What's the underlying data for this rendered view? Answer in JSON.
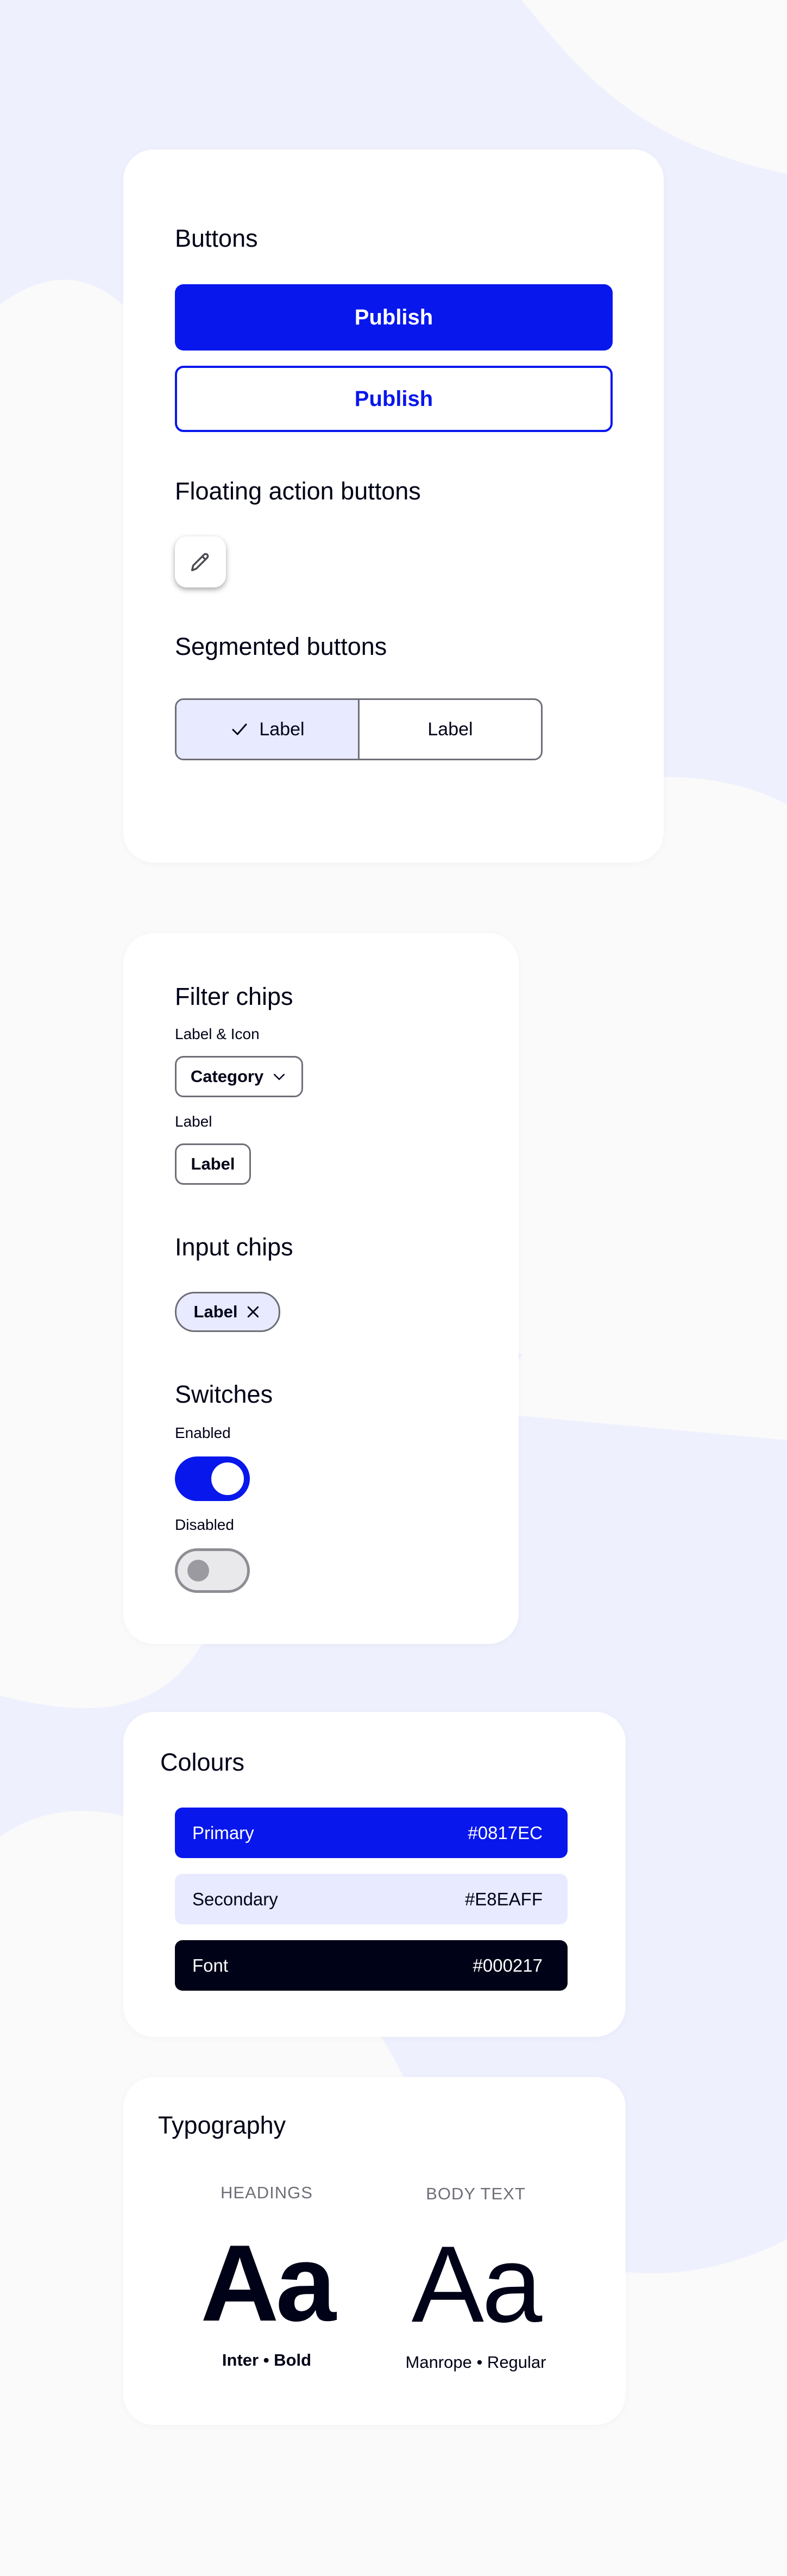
{
  "buttons_card": {
    "title": "Buttons",
    "primary_label": "Publish",
    "outline_label": "Publish",
    "fab_title": "Floating action buttons",
    "fab_icon": "pencil-icon",
    "segmented_title": "Segmented buttons",
    "segmented": [
      {
        "label": "Label",
        "selected": true
      },
      {
        "label": "Label",
        "selected": false
      }
    ]
  },
  "chips_card": {
    "filter_title": "Filter chips",
    "label_icon_caption": "Label & Icon",
    "category_chip": "Category",
    "label_caption": "Label",
    "label_chip": "Label",
    "input_title": "Input chips",
    "input_chip": "Label",
    "switches_title": "Switches",
    "enabled_caption": "Enabled",
    "disabled_caption": "Disabled",
    "switch_enabled_on": true,
    "switch_disabled_on": false
  },
  "colours_card": {
    "title": "Colours",
    "swatches": [
      {
        "name": "Primary",
        "hex": "#0817EC"
      },
      {
        "name": "Secondary",
        "hex": "#E8EAFF"
      },
      {
        "name": "Font",
        "hex": "#000217"
      }
    ]
  },
  "typography_card": {
    "title": "Typography",
    "headings": {
      "caption": "HEADINGS",
      "sample": "Aa",
      "name": "Inter • Bold"
    },
    "body": {
      "caption": "BODY TEXT",
      "sample": "Aa",
      "name": "Manrope • Regular"
    }
  },
  "theme": {
    "accent": "#0817EC",
    "accent_light": "#E8EAFF",
    "text": "#000217",
    "background": "#EEF0FD",
    "blob": "#FAFAFB"
  }
}
